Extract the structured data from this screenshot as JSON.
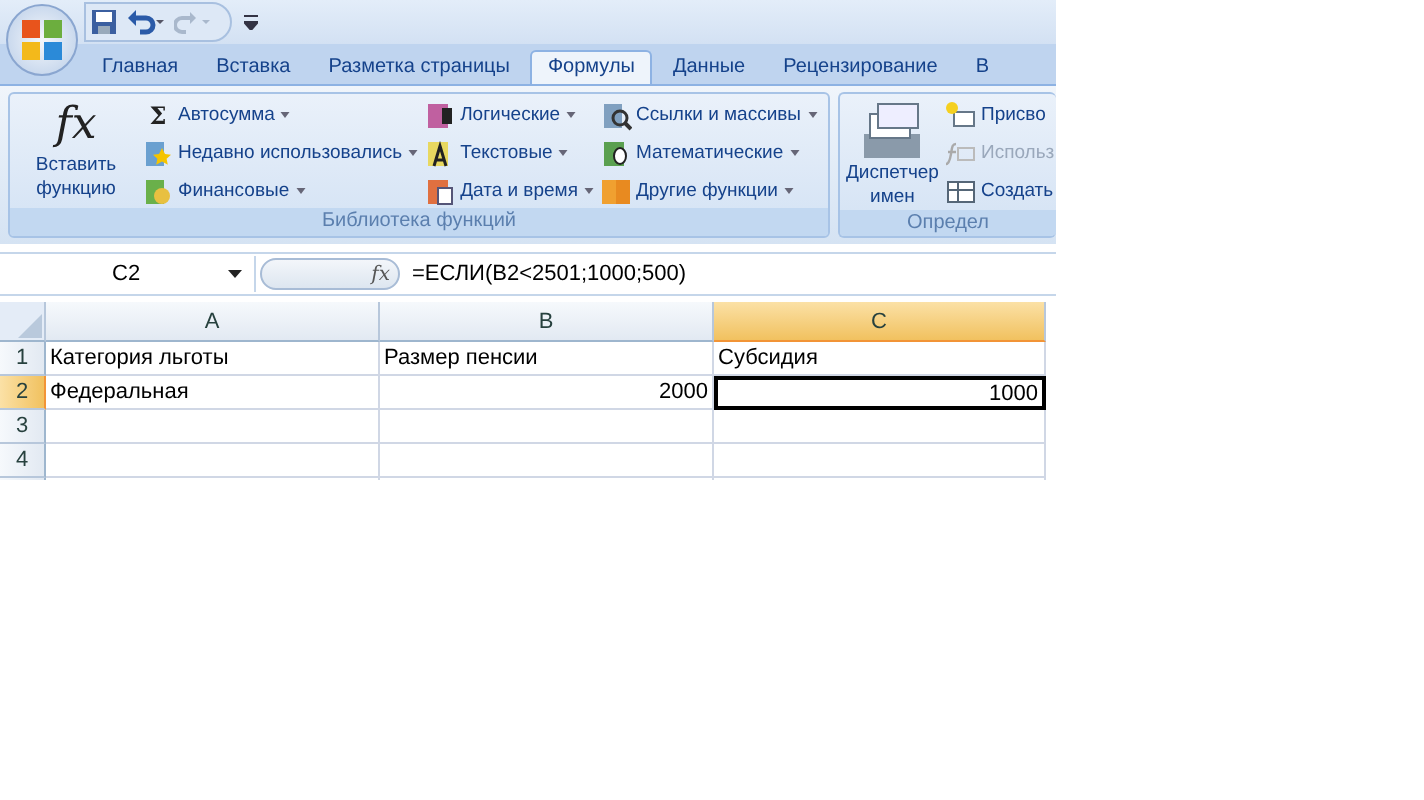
{
  "tabs": [
    {
      "label": "Главная",
      "selected": false
    },
    {
      "label": "Вставка",
      "selected": false
    },
    {
      "label": "Разметка страницы",
      "selected": false
    },
    {
      "label": "Формулы",
      "selected": true
    },
    {
      "label": "Данные",
      "selected": false
    },
    {
      "label": "Рецензирование",
      "selected": false
    },
    {
      "label": "В",
      "selected": false
    }
  ],
  "ribbon": {
    "groups": [
      {
        "label": "Библиотека функций",
        "large": {
          "icon_text": "fx",
          "label": "Вставить функцию"
        },
        "columns": [
          [
            {
              "label": "Автосумма",
              "icon_text": "Σ",
              "dropdown": true,
              "disabled": false
            },
            {
              "label": "Недавно использовались",
              "dropdown": true,
              "disabled": false
            },
            {
              "label": "Финансовые",
              "dropdown": true,
              "disabled": false
            }
          ],
          [
            {
              "label": "Логические",
              "dropdown": true,
              "disabled": false
            },
            {
              "label": "Текстовые",
              "dropdown": true,
              "disabled": false
            },
            {
              "label": "Дата и время",
              "dropdown": true,
              "disabled": false
            }
          ],
          [
            {
              "label": "Ссылки и массивы",
              "dropdown": true,
              "disabled": false
            },
            {
              "label": "Математические",
              "dropdown": true,
              "disabled": false
            },
            {
              "label": "Другие функции",
              "dropdown": true,
              "disabled": false
            }
          ]
        ]
      },
      {
        "label": "Определ",
        "large": {
          "label": "Диспетчер имен"
        },
        "columns": [
          [
            {
              "label": "Присво",
              "dropdown": false,
              "disabled": false
            },
            {
              "label": "Использ",
              "dropdown": false,
              "disabled": true
            },
            {
              "label": "Создать",
              "dropdown": false,
              "disabled": false
            }
          ]
        ]
      }
    ]
  },
  "formula_bar": {
    "name_box": "C2",
    "fx_button": "fx",
    "formula": "=ЕСЛИ(B2<2501;1000;500)"
  },
  "sheet": {
    "columns": [
      {
        "label": "A",
        "selected": false
      },
      {
        "label": "B",
        "selected": false
      },
      {
        "label": "C",
        "selected": true
      }
    ],
    "rows": [
      {
        "label": "1",
        "selected": false,
        "cells": [
          {
            "text": "Категория льготы",
            "right_aligned": false,
            "selected": false
          },
          {
            "text": "Размер пенсии",
            "right_aligned": false,
            "selected": false
          },
          {
            "text": "Субсидия",
            "right_aligned": false,
            "selected": false
          }
        ]
      },
      {
        "label": "2",
        "selected": true,
        "cells": [
          {
            "text": "Федеральная",
            "right_aligned": false,
            "selected": false
          },
          {
            "text": "2000",
            "right_aligned": true,
            "selected": false
          },
          {
            "text": "1000",
            "right_aligned": true,
            "selected": true
          }
        ]
      },
      {
        "label": "3",
        "selected": false
      },
      {
        "label": "4",
        "selected": false
      }
    ]
  }
}
